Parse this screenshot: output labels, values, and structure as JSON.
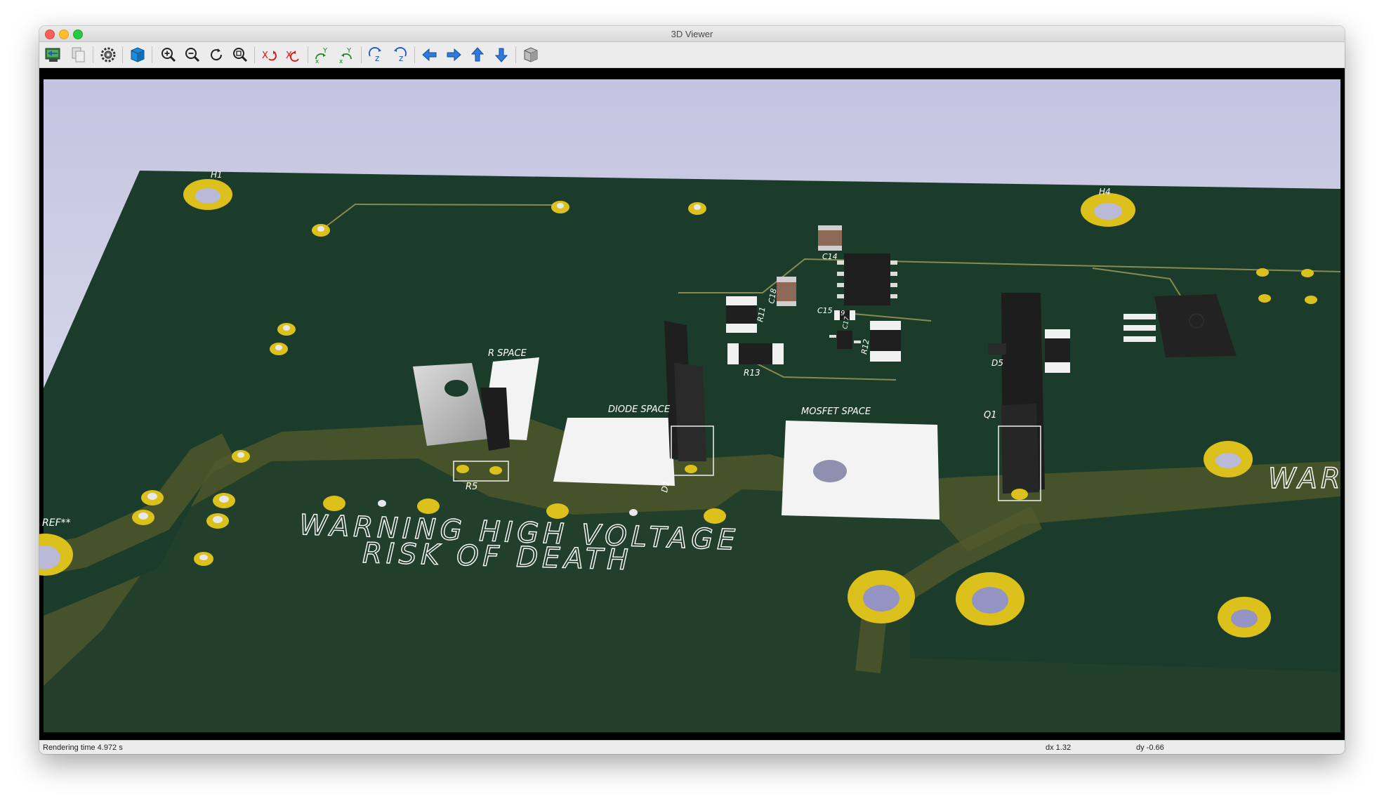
{
  "window": {
    "title": "3D Viewer"
  },
  "toolbar": {
    "buttons": [
      {
        "icon": "reload-board-icon"
      },
      {
        "icon": "copy-image-icon"
      },
      {
        "icon": "preferences-gear-icon"
      },
      {
        "icon": "raytracing-cube-icon"
      },
      {
        "icon": "zoom-in-icon"
      },
      {
        "icon": "zoom-out-icon"
      },
      {
        "icon": "zoom-redraw-icon"
      },
      {
        "icon": "zoom-fit-icon"
      },
      {
        "icon": "rotate-x-cw-icon"
      },
      {
        "icon": "rotate-x-ccw-icon"
      },
      {
        "icon": "rotate-y-cw-icon"
      },
      {
        "icon": "rotate-y-ccw-icon"
      },
      {
        "icon": "rotate-z-cw-icon"
      },
      {
        "icon": "rotate-z-ccw-icon"
      },
      {
        "icon": "move-left-icon"
      },
      {
        "icon": "move-right-icon"
      },
      {
        "icon": "move-up-icon"
      },
      {
        "icon": "move-down-icon"
      },
      {
        "icon": "ortho-view-cube-icon"
      }
    ]
  },
  "board": {
    "silkscreen_warning_line1": "WARNING HIGH VOLTAGE",
    "silkscreen_warning_line2": "RISK OF DEATH",
    "silkscreen_right_warning": "WAR",
    "labels": {
      "h1": "H1",
      "h4": "H4",
      "ref": "REF**",
      "r_space": "R SPACE",
      "diode_space": "DIODE SPACE",
      "mosfet_space": "MOSFET SPACE",
      "r5": "R5",
      "d1": "D1",
      "q1": "Q1",
      "d5": "D5",
      "r11": "R11",
      "r12": "R12",
      "r13": "R13",
      "c14": "C14",
      "c15": "C15",
      "c18": "C18",
      "r9": "R9",
      "c17": "C17"
    },
    "colors": {
      "sky": "#c6c6e2",
      "pcb": "#1c3d2b",
      "copper": "#5a5a2e",
      "pad": "#e0c21d",
      "silk": "#ffffff"
    }
  },
  "status": {
    "rendering": "Rendering time 4.972 s",
    "dx": "dx 1.32",
    "dy": "dy -0.66"
  }
}
